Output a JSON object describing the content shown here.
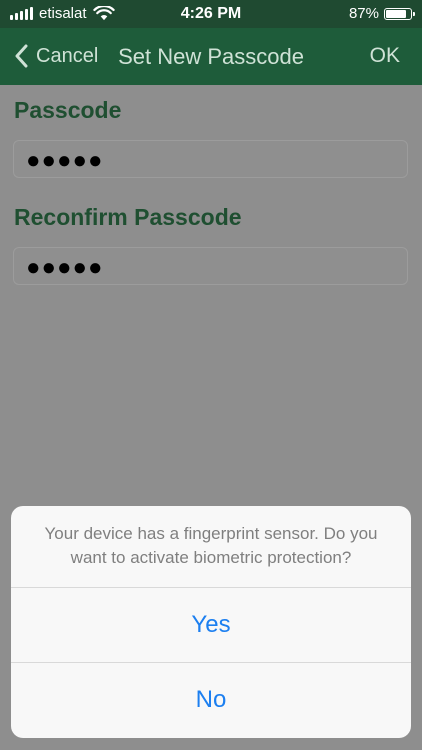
{
  "status_bar": {
    "carrier": "etisalat",
    "time": "4:26 PM",
    "battery_percent": "87%",
    "battery_level": 0.87
  },
  "nav": {
    "cancel_label": "Cancel",
    "title": "Set New Passcode",
    "ok_label": "OK"
  },
  "form": {
    "passcode_label": "Passcode",
    "passcode_value": "●●●●●",
    "reconfirm_label": "Reconfirm Passcode",
    "reconfirm_value": "●●●●●"
  },
  "action_sheet": {
    "message": "Your device has a fingerprint sensor. Do you want to activate biometric protection?",
    "yes_label": "Yes",
    "no_label": "No"
  },
  "colors": {
    "nav_bg": "#1e5c3a",
    "label_green": "#1f4f31",
    "accent_blue": "#1c7ff0"
  }
}
